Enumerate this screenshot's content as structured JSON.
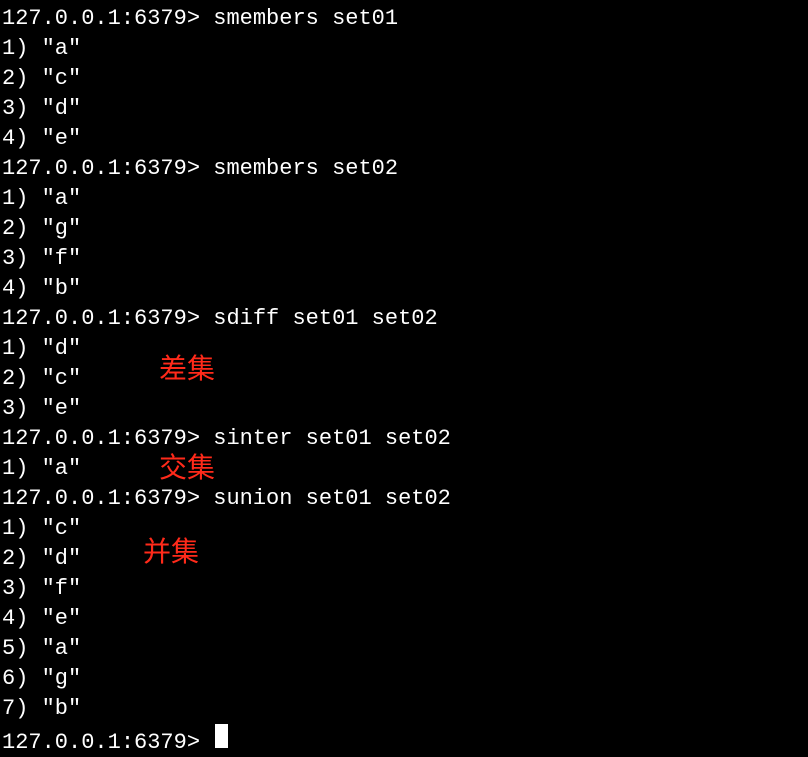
{
  "prompt": "127.0.0.1:6379>",
  "commands": {
    "cmd1": "smembers set01",
    "cmd2": "smembers set02",
    "cmd3": "sdiff set01 set02",
    "cmd4": "sinter set01 set02",
    "cmd5": "sunion set01 set02"
  },
  "results": {
    "smembers_set01": [
      "1) \"a\"",
      "2) \"c\"",
      "3) \"d\"",
      "4) \"e\""
    ],
    "smembers_set02": [
      "1) \"a\"",
      "2) \"g\"",
      "3) \"f\"",
      "4) \"b\""
    ],
    "sdiff": [
      "1) \"d\"",
      "2) \"c\"",
      "3) \"e\""
    ],
    "sinter": [
      "1) \"a\""
    ],
    "sunion": [
      "1) \"c\"",
      "2) \"d\"",
      "3) \"f\"",
      "4) \"e\"",
      "5) \"a\"",
      "6) \"g\"",
      "7) \"b\""
    ]
  },
  "annotations": {
    "diff": "差集",
    "intersect": "交集",
    "union": "并集"
  },
  "colors": {
    "background": "#000000",
    "text": "#ffffff",
    "annotation": "#ff2a1a"
  }
}
